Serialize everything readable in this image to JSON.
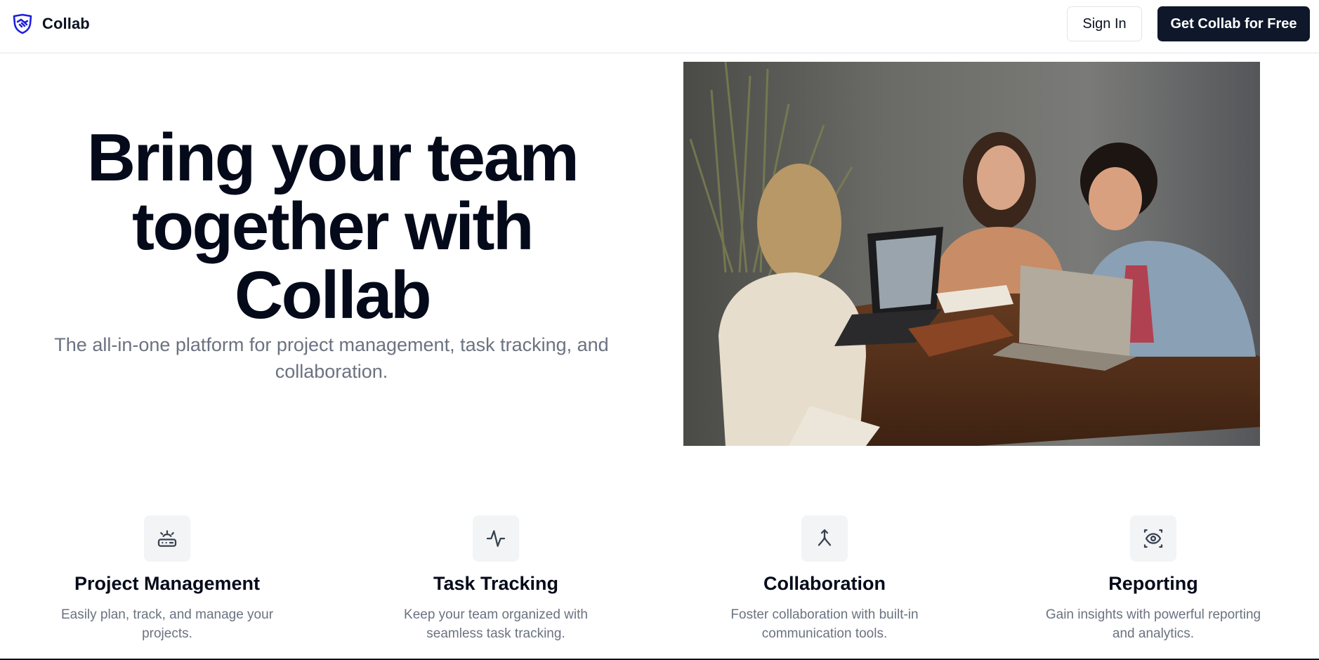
{
  "header": {
    "brand_name": "Collab",
    "brand_icon": "handshake-shield-icon",
    "signin_label": "Sign In",
    "cta_label": "Get Collab for Free"
  },
  "hero": {
    "title_line1": "Bring your team",
    "title_line2": "together with",
    "title_line3": "Collab",
    "subtitle": "The all-in-one platform for project management, task tracking, and collaboration.",
    "image": "photo of three people laughing around a table with laptops"
  },
  "features": [
    {
      "icon": "router-icon",
      "title": "Project Management",
      "description": "Easily plan, track, and manage your projects."
    },
    {
      "icon": "activity-icon",
      "title": "Task Tracking",
      "description": "Keep your team organized with seamless task tracking."
    },
    {
      "icon": "merge-icon",
      "title": "Collaboration",
      "description": "Foster collaboration with built-in communication tools."
    },
    {
      "icon": "view-icon",
      "title": "Reporting",
      "description": "Gain insights with powerful reporting and analytics."
    }
  ],
  "colors": {
    "primary": "#0f172a",
    "brand_icon": "#1d1de0",
    "muted_text": "#6b7280",
    "icon_bg": "#f3f4f6"
  }
}
